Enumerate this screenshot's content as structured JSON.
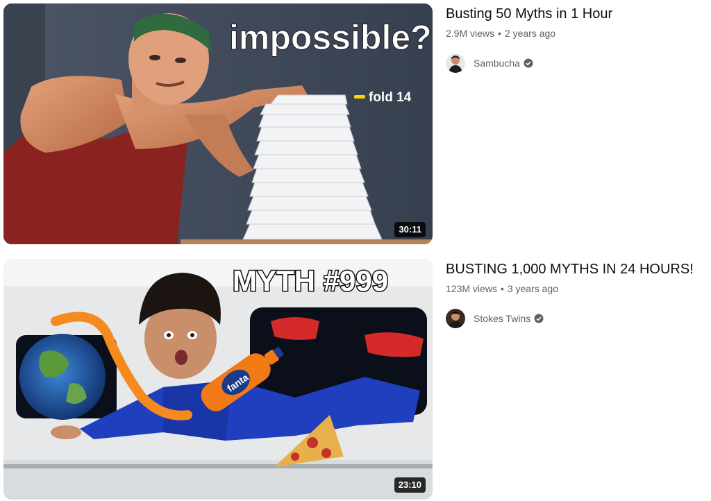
{
  "videos": [
    {
      "title": "Busting 50 Myths in 1 Hour",
      "views": "2.9M views",
      "age": "2 years ago",
      "channel": "Sambucha",
      "duration": "30:11",
      "thumb_text": "impossible?",
      "thumb_caption": "fold 14",
      "verified_icon": "verified-check-icon"
    },
    {
      "title": "BUSTING 1,000 MYTHS IN 24 HOURS!",
      "views": "123M views",
      "age": "3 years ago",
      "channel": "Stokes Twins",
      "duration": "23:10",
      "thumb_text": "MYTH #999",
      "thumb_bottle_text": "fanta",
      "verified_icon": "verified-check-icon"
    }
  ],
  "colors": {
    "title": "#0f0f0f",
    "secondary": "#606060",
    "duration_bg": "#000000"
  }
}
